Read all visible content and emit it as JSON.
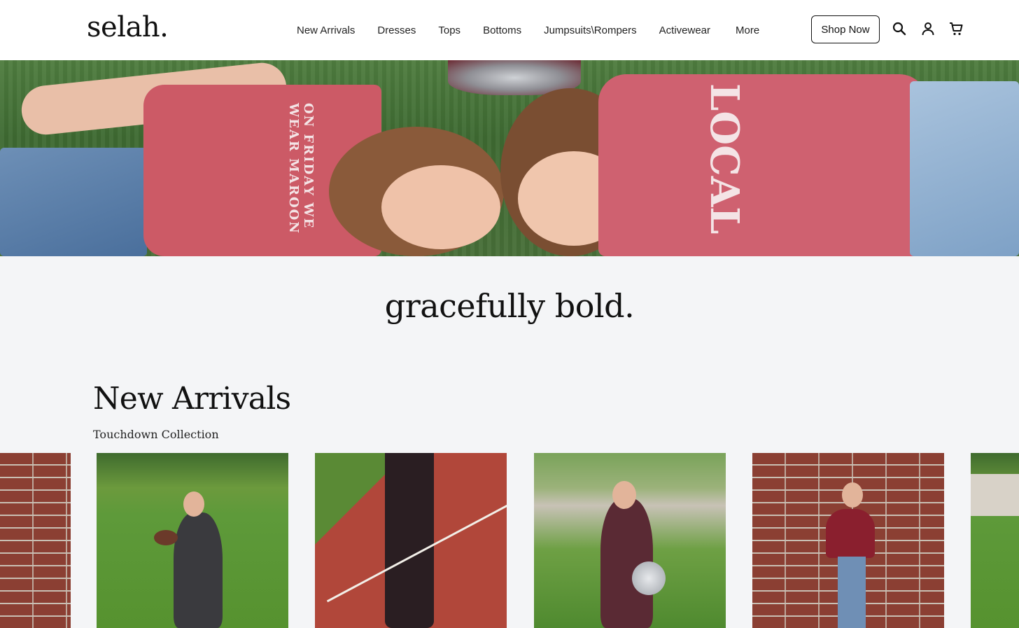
{
  "brand": {
    "logo_text": "selah."
  },
  "nav": {
    "items": [
      "New Arrivals",
      "Dresses",
      "Tops",
      "Bottoms",
      "Jumpsuits\\Rompers",
      "Activewear",
      "More"
    ]
  },
  "header_actions": {
    "shop_now_label": "Shop Now",
    "icons": [
      "search-icon",
      "account-icon",
      "cart-icon"
    ]
  },
  "hero": {
    "image_alt": "Two girls in maroon shirts lying on grass",
    "shirt_text_left": "ON FRIDAY WE WEAR MAROON",
    "shirt_text_right": "LOCAL"
  },
  "tagline": "gracefully bold.",
  "section": {
    "title": "New Arrivals",
    "subtitle": "Touchdown Collection"
  },
  "products": [
    {
      "name": "Brick wall product (partial)",
      "scene": "brick"
    },
    {
      "name": "Grey hoodie set",
      "scene": "turf"
    },
    {
      "name": "Black flare pants",
      "scene": "track"
    },
    {
      "name": "Maroon active set",
      "scene": "stands"
    },
    {
      "name": "Maroon top",
      "scene": "brick"
    },
    {
      "name": "Field product (partial)",
      "scene": "turf"
    }
  ],
  "colors": {
    "header_bg": "#ffffff",
    "page_bg": "#f4f5f7",
    "accent_maroon": "#7a2a33",
    "shirt_pink": "#cc5a66"
  }
}
